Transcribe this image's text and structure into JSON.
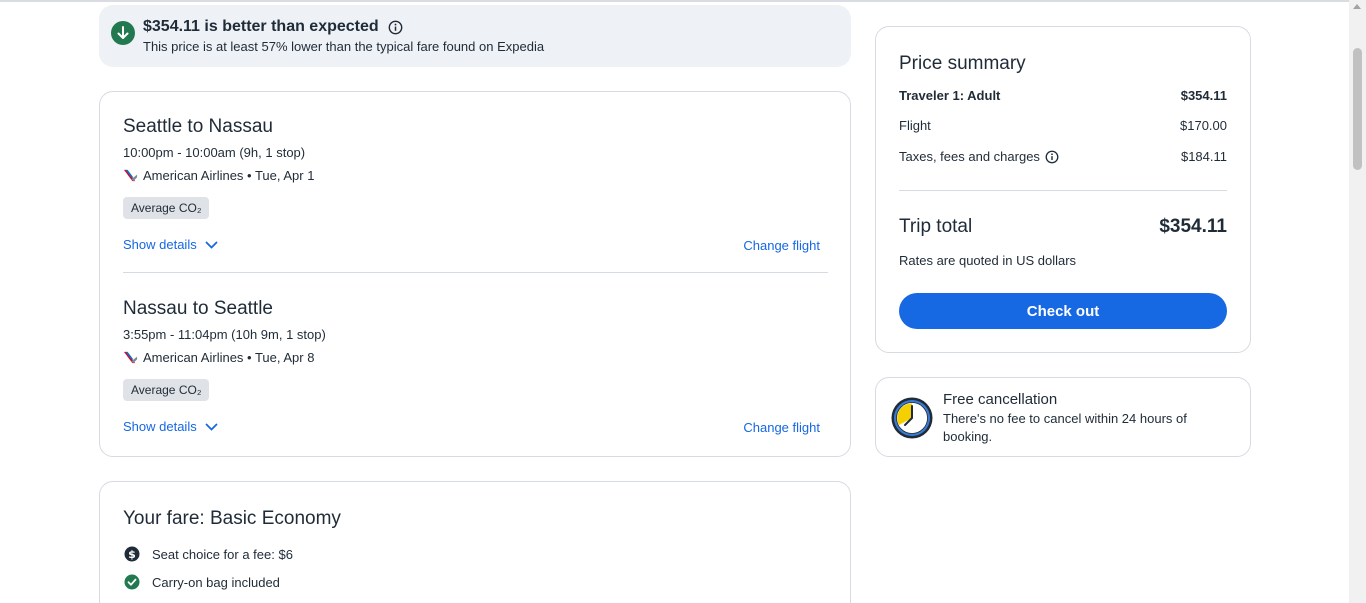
{
  "banner": {
    "title": "$354.11 is better than expected",
    "subtitle": "This price is at least 57% lower than the typical fare found on Expedia"
  },
  "segments": [
    {
      "route": "Seattle to Nassau",
      "time": "10:00pm - 10:00am (9h, 1 stop)",
      "airline": "American Airlines • Tue, Apr 1",
      "co2_label": "Average CO₂",
      "details_label": "Show details",
      "change_label": "Change flight"
    },
    {
      "route": "Nassau to Seattle",
      "time": "3:55pm - 11:04pm (10h 9m, 1 stop)",
      "airline": "American Airlines • Tue, Apr 8",
      "co2_label": "Average CO₂",
      "details_label": "Show details",
      "change_label": "Change flight"
    }
  ],
  "fare": {
    "title": "Your fare: Basic Economy",
    "items": [
      {
        "icon": "dollar-icon",
        "text": "Seat choice for a fee: $6"
      },
      {
        "icon": "check-circle-icon",
        "text": "Carry-on bag included"
      }
    ]
  },
  "summary": {
    "title": "Price summary",
    "traveler_label": "Traveler 1: Adult",
    "traveler_amount": "$354.11",
    "flight_label": "Flight",
    "flight_amount": "$170.00",
    "taxes_label": "Taxes, fees and charges",
    "taxes_amount": "$184.11",
    "total_label": "Trip total",
    "total_amount": "$354.11",
    "rates_note": "Rates are quoted in US dollars",
    "checkout_label": "Check out"
  },
  "cancellation": {
    "title": "Free cancellation",
    "text": "There's no fee to cancel within 24 hours of booking."
  },
  "colors": {
    "accent": "#1668e3",
    "success": "#227950",
    "text": "#1f2b37",
    "banner_bg": "#eef1f6",
    "border": "#d6dbe1"
  }
}
